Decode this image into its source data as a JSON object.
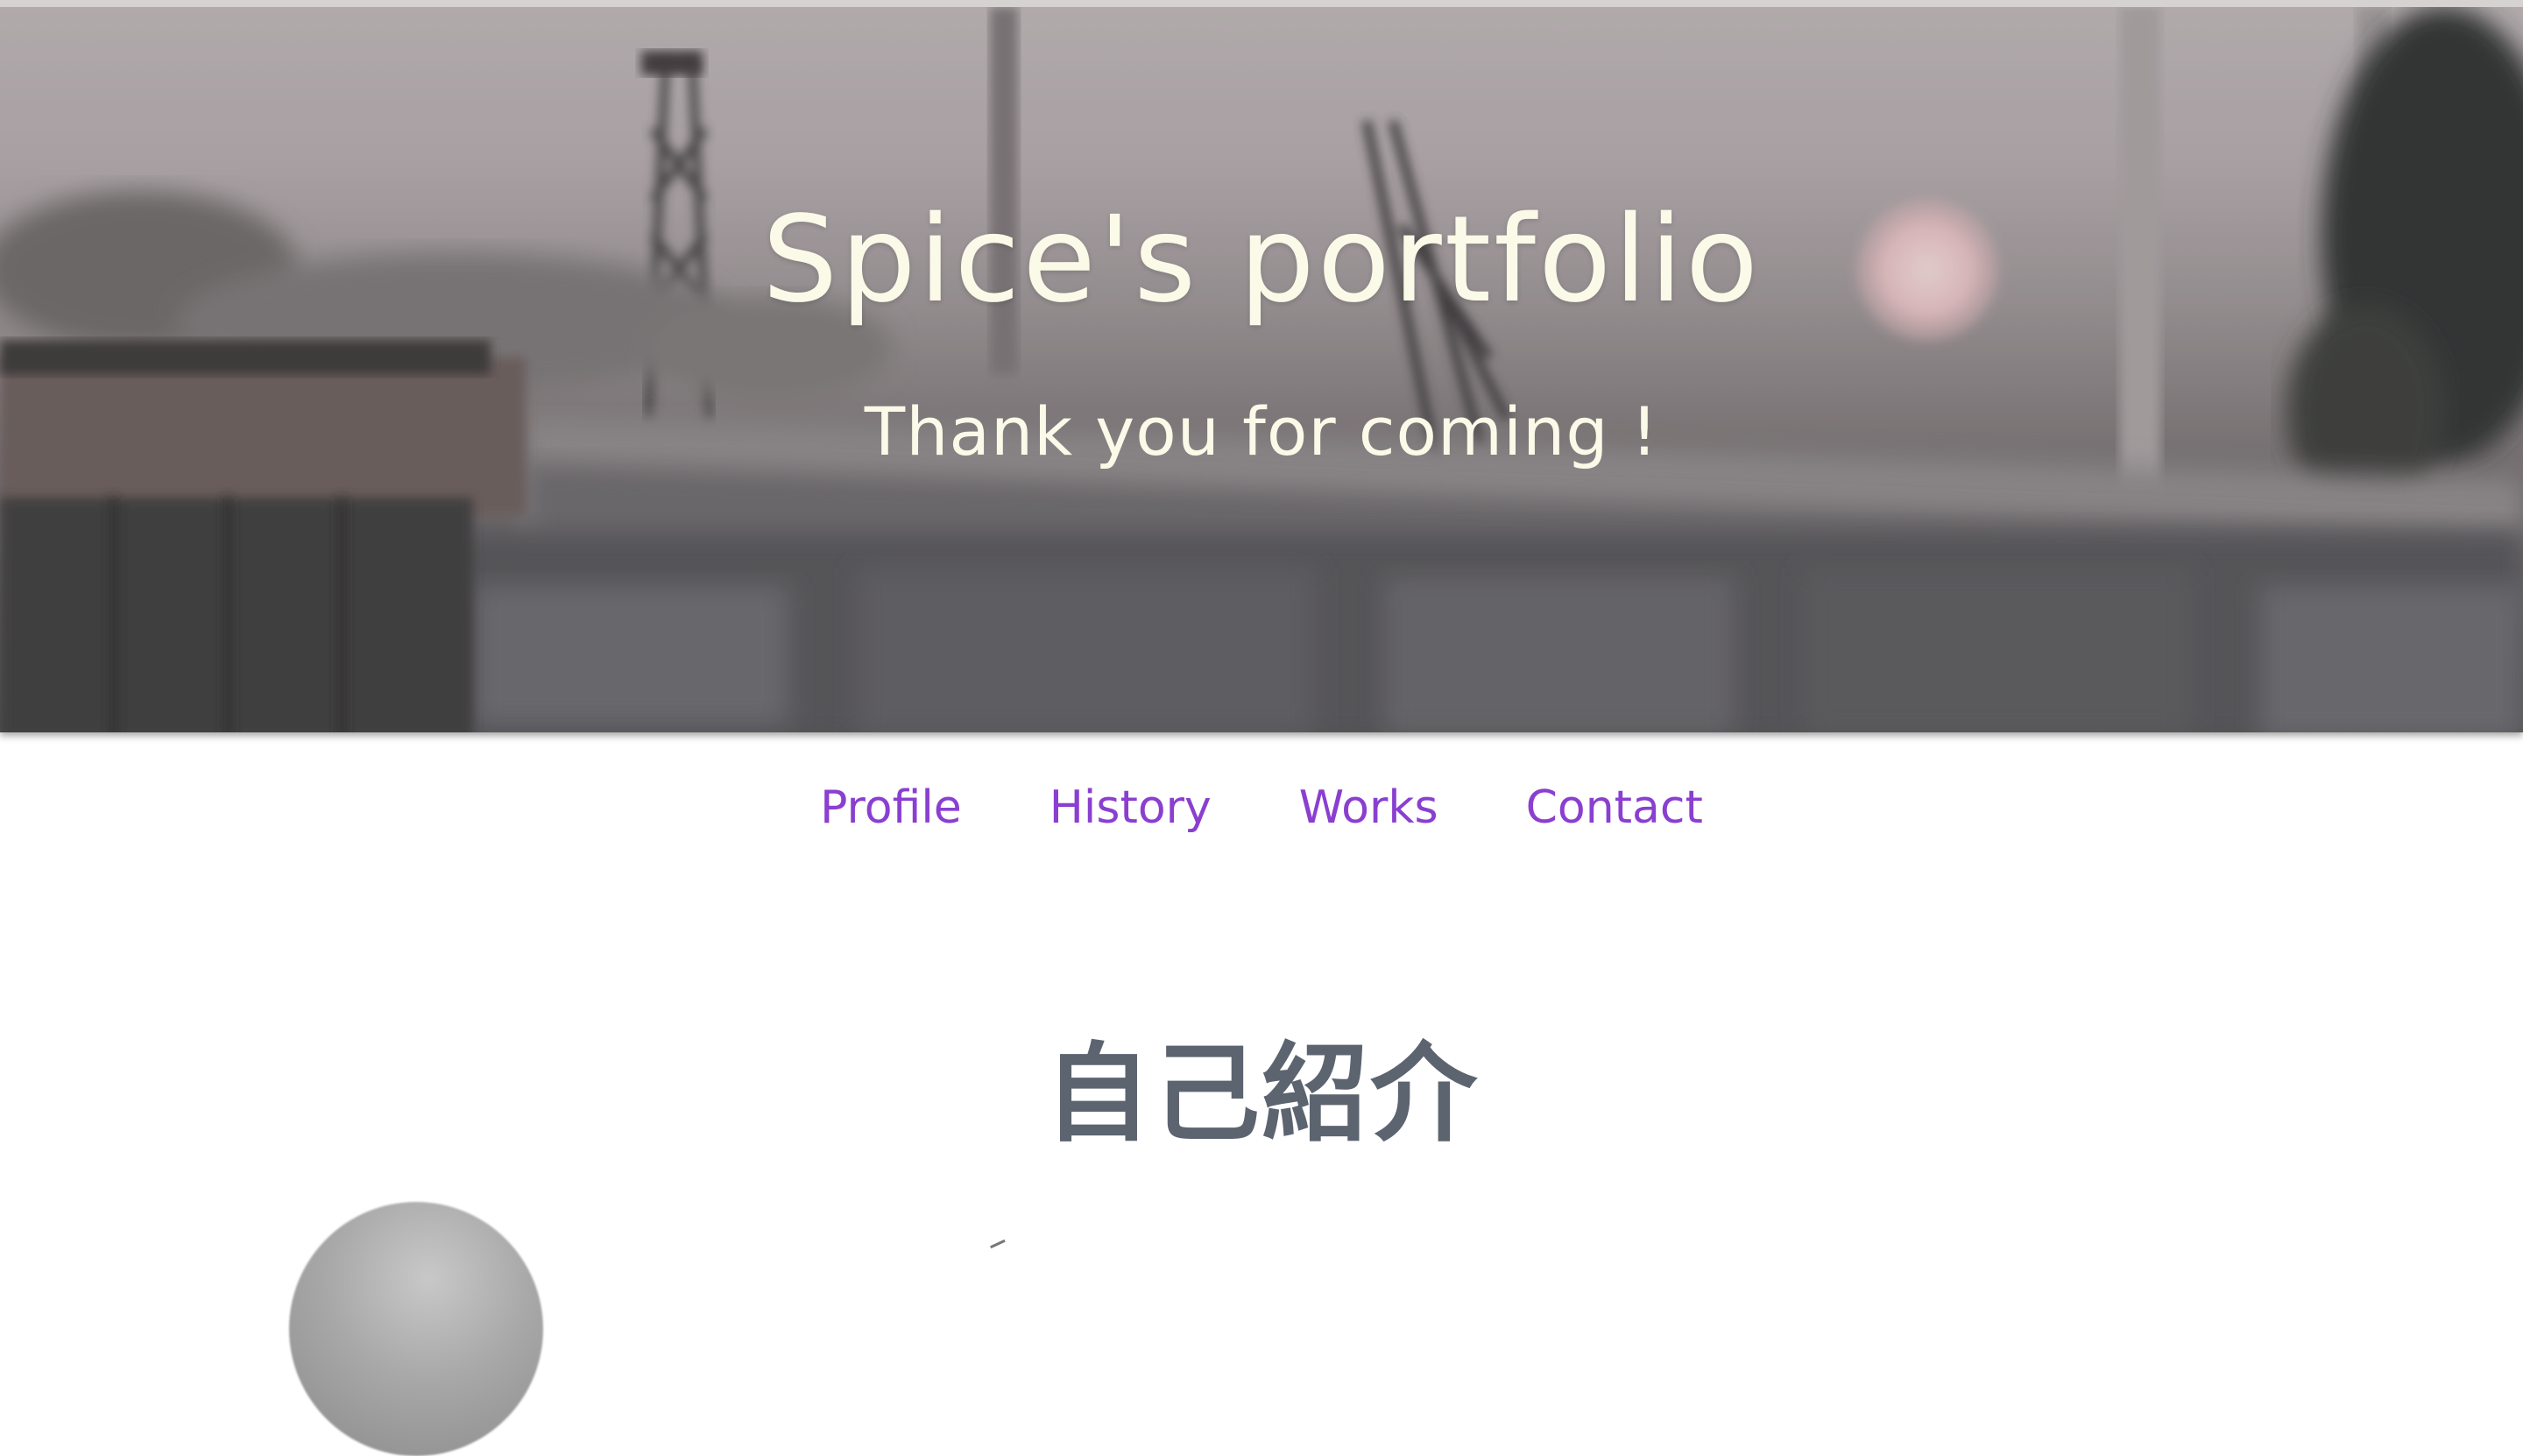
{
  "hero": {
    "title": "Spice's portfolio",
    "subtitle": "Thank you for coming !"
  },
  "nav": {
    "items": [
      "Profile",
      "History",
      "Works",
      "Contact"
    ],
    "link_color": "#8a3fd0"
  },
  "section": {
    "title": "自己紹介"
  },
  "icons": {
    "avatar": "profile-photo"
  }
}
